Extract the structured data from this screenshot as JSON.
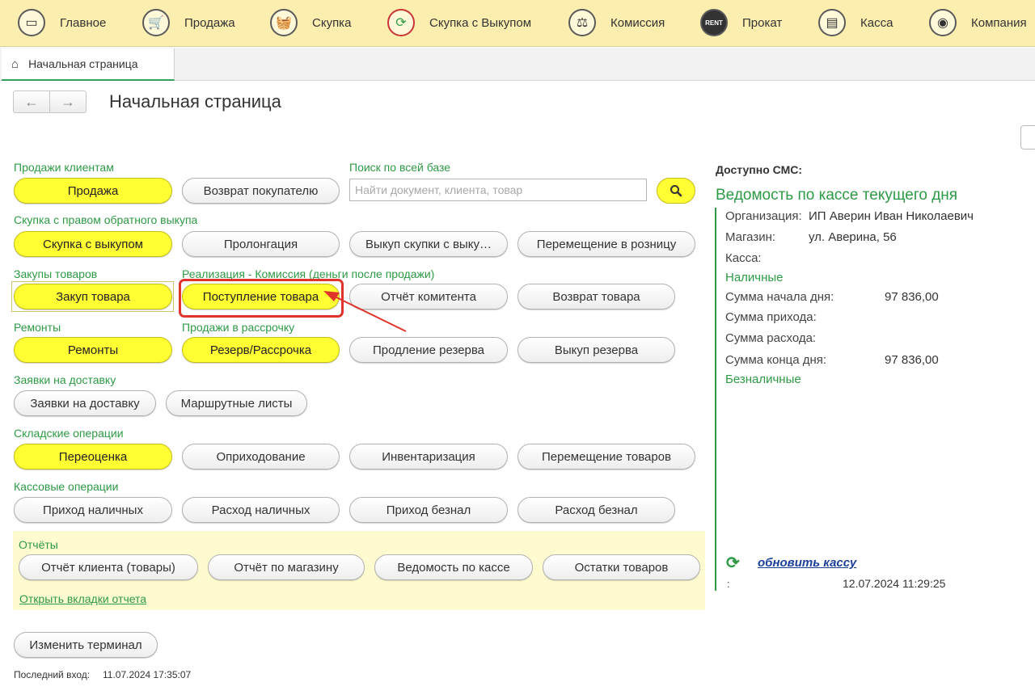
{
  "top_nav": [
    {
      "label": "Главное",
      "icon": "monitor-icon",
      "glyph": "▭"
    },
    {
      "label": "Продажа",
      "icon": "cart-icon",
      "glyph": "🛒"
    },
    {
      "label": "Скупка",
      "icon": "basket-icon",
      "glyph": "🧺"
    },
    {
      "label": "Скупка с Выкупом",
      "icon": "cycle-arrows-icon",
      "glyph": "⟳"
    },
    {
      "label": "Комиссия",
      "icon": "scales-icon",
      "glyph": "⚖"
    },
    {
      "label": "Прокат",
      "icon": "rent-icon",
      "glyph": "RENT"
    },
    {
      "label": "Касса",
      "icon": "cash-register-icon",
      "glyph": "▤"
    },
    {
      "label": "Компания",
      "icon": "company-icon",
      "glyph": "◉"
    }
  ],
  "tab": {
    "label": "Начальная страница"
  },
  "header": {
    "title": "Начальная страница",
    "back": "←",
    "forward": "→"
  },
  "sections": {
    "sales": {
      "label": "Продажи клиентам",
      "sale": "Продажа",
      "return": "Возврат покупателю"
    },
    "search": {
      "label": "Поиск по всей базе",
      "placeholder": "Найти документ, клиента, товар"
    },
    "buyback": {
      "label": "Скупка с правом обратного выкупа",
      "buyback": "Скупка с выкупом",
      "prolong": "Пролонгация",
      "redeem": "Выкуп скупки с выку…",
      "move": "Перемещение в розницу"
    },
    "purchases": {
      "label": "Закупы товаров",
      "purchase": "Закуп товара"
    },
    "commission": {
      "label": "Реализация - Комиссия (деньги после продажи)",
      "receipt": "Поступление товара",
      "report": "Отчёт комитента",
      "return": "Возврат товара"
    },
    "repairs": {
      "label": "Ремонты",
      "repairs": "Ремонты"
    },
    "installments": {
      "label": "Продажи в рассрочку",
      "reserve": "Резерв/Рассрочка",
      "extend": "Продление резерва",
      "redeem": "Выкуп резерва"
    },
    "delivery": {
      "label": "Заявки на доставку",
      "orders": "Заявки на доставку",
      "routes": "Маршрутные листы"
    },
    "warehouse": {
      "label": "Складские операции",
      "revalue": "Переоценка",
      "capitalize": "Оприходование",
      "inventory": "Инвентаризация",
      "move": "Перемещение товаров"
    },
    "cash": {
      "label": "Кассовые операции",
      "cash_in": "Приход наличных",
      "cash_out": "Расход наличных",
      "card_in": "Приход безнал",
      "card_out": "Расход безнал"
    },
    "reports": {
      "label": "Отчёты",
      "client": "Отчёт клиента (товары)",
      "store": "Отчёт по магазину",
      "cashbook": "Ведомость по кассе",
      "stock": "Остатки товаров",
      "open_tabs": "Открыть вкладки отчета"
    }
  },
  "footer": {
    "change_terminal": "Изменить терминал",
    "last_login_label": "Последний вход:",
    "last_login_value": "11.07.2024 17:35:07"
  },
  "right_panel": {
    "sms_label": "Доступно СМС:",
    "title": "Ведомость по кассе текущего дня",
    "org_label": "Организация:",
    "org_value": "ИП Аверин Иван Николаевич",
    "store_label": "Магазин:",
    "store_value": "ул. Аверина, 56",
    "register_label": "Касса:",
    "cash_label": "Наличные",
    "start_label": "Сумма начала дня:",
    "start_value": "97 836,00",
    "income_label": "Сумма прихода:",
    "expense_label": "Сумма расхода:",
    "end_label": "Сумма конца дня:",
    "end_value": "97 836,00",
    "cashless_label": "Безналичные",
    "refresh_label": "обновить кассу",
    "colon": ":",
    "timestamp": "12.07.2024 11:29:25"
  },
  "colors": {
    "accent_green": "#2e9a45",
    "button_yellow": "#ffff33",
    "topbar": "#fbeeaf",
    "highlight_red": "#e0332b"
  }
}
